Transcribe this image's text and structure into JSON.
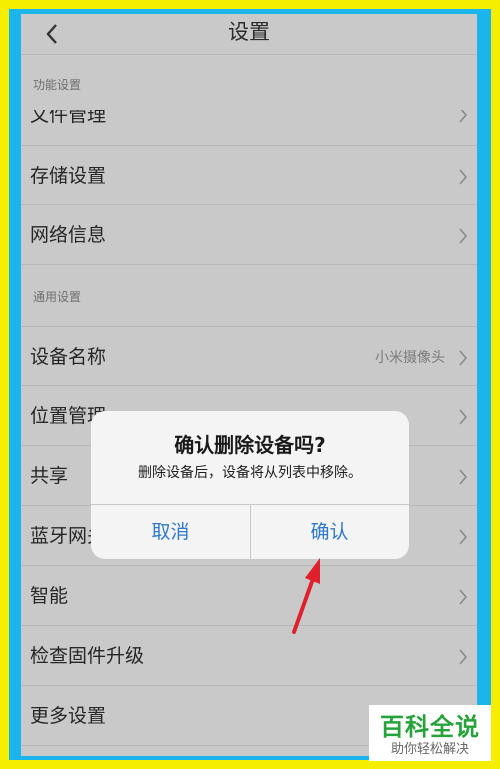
{
  "header": {
    "title": "设置",
    "back_icon": "chevron-left-icon"
  },
  "sections": {
    "function": "功能设置",
    "general": "通用设置"
  },
  "rows": {
    "file_manage": "文件管理",
    "storage": "存储设置",
    "network": "网络信息",
    "device_name": {
      "label": "设备名称",
      "value": "小米摄像头"
    },
    "location": "位置管理",
    "share": "共享",
    "bluetooth": "蓝牙网关",
    "smart": "智能",
    "firmware": "检查固件升级",
    "more": "更多设置"
  },
  "dialog": {
    "title": "确认删除设备吗?",
    "message": "删除设备后，设备将从列表中移除。",
    "cancel": "取消",
    "confirm": "确认"
  },
  "watermark": {
    "main": "百科全说",
    "sub": "助你轻松解决"
  },
  "colors": {
    "frame_border": "#f6ee00",
    "frame_bg": "#19b5ec",
    "dialog_button": "#2f79c8",
    "annotation_arrow": "#e0202a",
    "watermark_text": "#27a33b"
  }
}
